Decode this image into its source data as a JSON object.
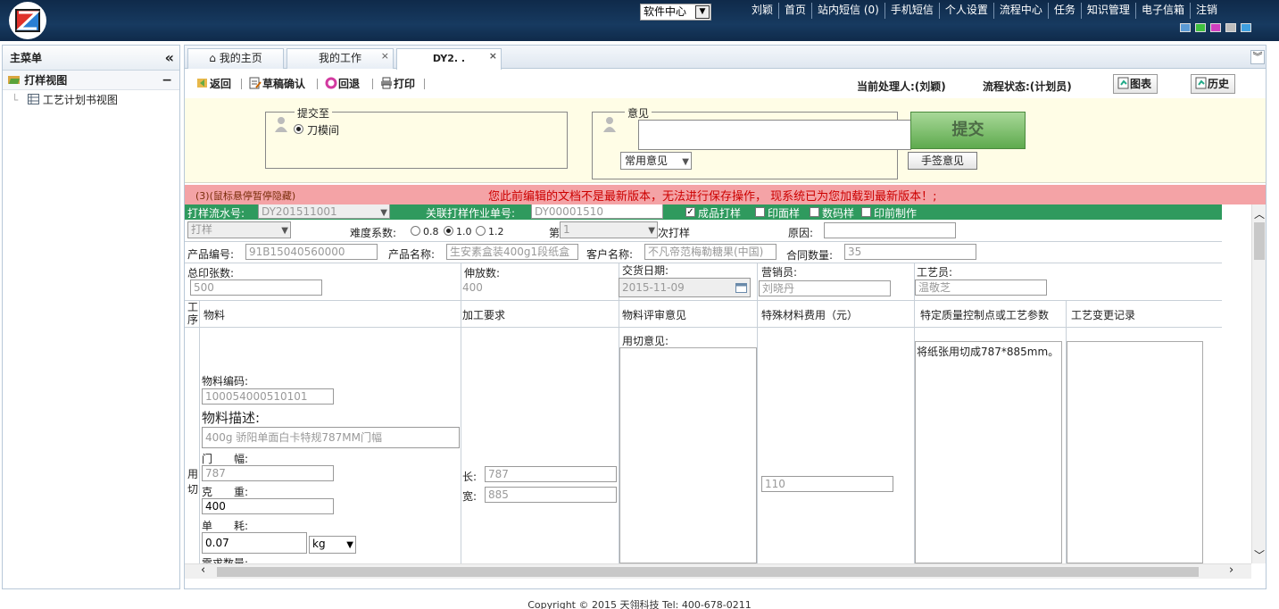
{
  "header": {
    "app_switch": "软件中心",
    "nav": [
      "刘颖",
      "首页",
      "站内短信 (0)",
      "手机短信",
      "个人设置",
      "流程中心",
      "任务",
      "知识管理",
      "电子信箱",
      "注销"
    ],
    "theme_colors": [
      "#5b9bd5",
      "#3fbf3f",
      "#d040c0",
      "#bdbdbd",
      "#3fa0e0"
    ]
  },
  "sidebar": {
    "title": "主菜单",
    "group": "打样视图",
    "items": [
      "工艺计划书视图"
    ]
  },
  "tabs": [
    {
      "label": "我的主页"
    },
    {
      "label": "我的工作"
    },
    {
      "label": "DY2. ."
    }
  ],
  "toolbar": {
    "back": "返回",
    "draft_confirm": "草稿确认",
    "rollback": "回退",
    "print": "打印",
    "current_handler": "当前处理人:(刘颖)",
    "flow_status": "流程状态:(计划员)",
    "chart": "图表",
    "history": "历史"
  },
  "submit": {
    "submit_to_legend": "提交至",
    "target": "刀模间",
    "opinion_legend": "意见",
    "submit_button": "提交",
    "common_opinion": "常用意见",
    "sign_button": "手签意见"
  },
  "warning": {
    "hover_hint": "(3)(鼠标悬停暂停隐藏)",
    "message": "您此前编辑的文档不是最新版本，无法进行保存操作，  现系统已为您加载到最新版本！;"
  },
  "form": {
    "serial_label": "打样流水号:",
    "serial_value": "DY201511001",
    "job_label": "关联打样作业单号:",
    "job_value": "DY00001510",
    "checks": [
      {
        "label": "成品打样",
        "checked": true
      },
      {
        "label": "印面样",
        "checked": false
      },
      {
        "label": "数码样",
        "checked": false
      },
      {
        "label": "印前制作",
        "checked": false
      }
    ],
    "type_value": "打样",
    "difficulty_label": "难度系数:",
    "difficulty_options": [
      "0.8",
      "1.0",
      "1.2"
    ],
    "difficulty_selected": "1.0",
    "round_prefix": "第",
    "round_value": "1",
    "round_suffix": "次打样",
    "reason_label": "原因:",
    "product_code_label": "产品编号:",
    "product_code": "91B15040560000",
    "product_name_label": "产品名称:",
    "product_name": "生安素盒装400g1段纸盒",
    "customer_label": "客户名称:",
    "customer": "不凡帝范梅勒糖果(中国)",
    "contract_qty_label": "合同数量:",
    "contract_qty": "35",
    "total_sheets_label": "总印张数:",
    "total_sheets": "500",
    "extra_label": "伸放数:",
    "extra_value": "400",
    "delivery_label": "交货日期:",
    "delivery_date": "2015-11-09",
    "sales_label": "营销员:",
    "sales": "刘晓丹",
    "craft_label": "工艺员:",
    "craft": "温敬芝",
    "columns": [
      "工序",
      "物料",
      "加工要求",
      "物料评审意见",
      "特殊材料费用（元）",
      "特定质量控制点或工艺参数",
      "工艺变更记录"
    ],
    "process_name": "用切",
    "material_code_label": "物料编码:",
    "material_code": "100054000510101",
    "material_desc_label": "物料描述:",
    "material_desc": "400g 骄阳单面白卡特规787MM门幅",
    "width_label": "门　　幅:",
    "width_value": "787",
    "weight_label": "克　　重:",
    "weight_value": "400",
    "consumption_label": "单　　耗:",
    "consumption_value": "0.07",
    "unit": "kg",
    "demand_label": "需求数量:",
    "length_label": "长:",
    "length_value": "787",
    "breadth_label": "宽:",
    "breadth_value": "885",
    "cut_opinion_label": "用切意见:",
    "special_fee": "110",
    "quality_note": "将纸张用切成787*885mm。"
  },
  "footer": "Copyright © 2015 天翎科技 Tel: 400-678-0211"
}
